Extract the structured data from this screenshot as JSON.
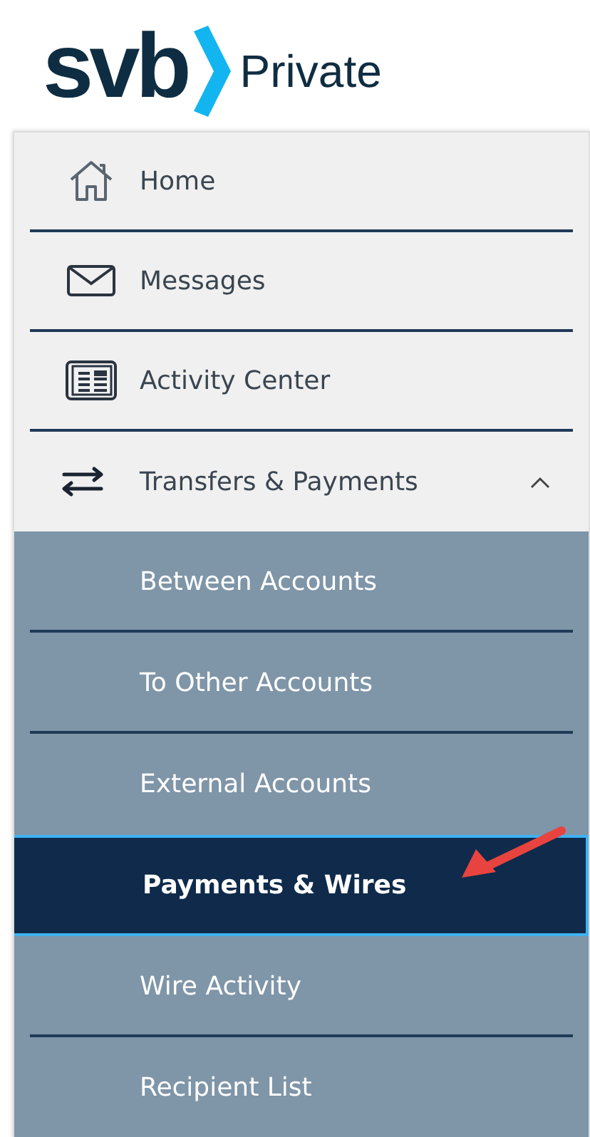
{
  "logo": {
    "brand": "svb",
    "product": "Private"
  },
  "menu": [
    {
      "label": "Home"
    },
    {
      "label": "Messages"
    },
    {
      "label": "Activity Center"
    },
    {
      "label": "Transfers & Payments",
      "expanded": true,
      "children": [
        {
          "label": "Between Accounts",
          "selected": false
        },
        {
          "label": "To Other Accounts",
          "selected": false
        },
        {
          "label": "External Accounts",
          "selected": false
        },
        {
          "label": "Payments & Wires",
          "selected": true
        },
        {
          "label": "Wire Activity",
          "selected": false
        },
        {
          "label": "Recipient List",
          "selected": false
        }
      ]
    }
  ]
}
